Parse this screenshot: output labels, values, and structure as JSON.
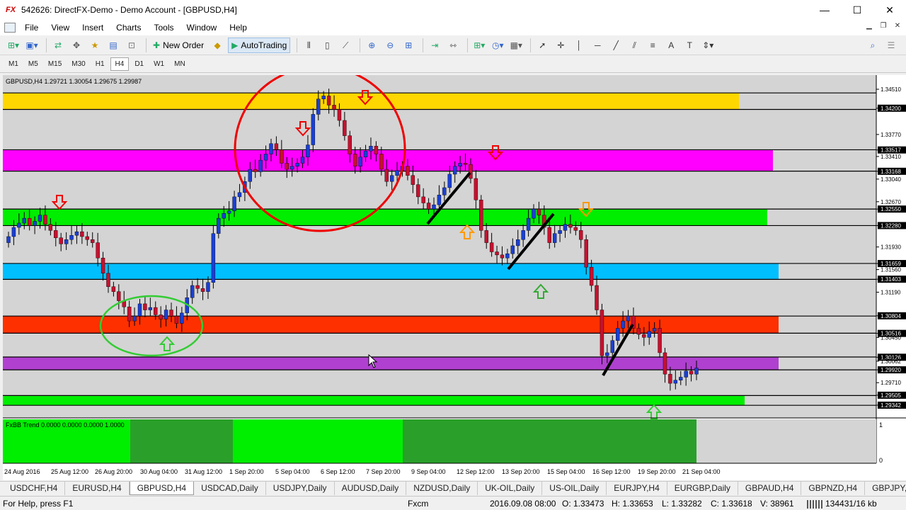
{
  "window": {
    "title": "542626: DirectFX-Demo - Demo Account - [GBPUSD,H4]",
    "app_icon": "FX",
    "minimize": "—",
    "maximize": "☐",
    "close": "✕"
  },
  "menu": [
    "File",
    "View",
    "Insert",
    "Charts",
    "Tools",
    "Window",
    "Help"
  ],
  "toolbar": {
    "new_order": "New Order",
    "autotrading": "AutoTrading"
  },
  "timeframes": [
    "M1",
    "M5",
    "M15",
    "M30",
    "H1",
    "H4",
    "D1",
    "W1",
    "MN"
  ],
  "active_timeframe": "H4",
  "chart": {
    "header": "GBPUSD,H4  1.29721 1.30054 1.29675 1.29987",
    "indicator_label": "FxBB Trend 0.0000 0.0000 0.0000 1.0000",
    "indicator_scale_top": "1",
    "indicator_scale_bottom": "0",
    "price_labels": [
      "1.34510",
      "1.34200",
      "1.33770",
      "1.33517",
      "1.33410",
      "1.33168",
      "1.33040",
      "1.32670",
      "1.32550",
      "1.32280",
      "1.31930",
      "1.31659",
      "1.31560",
      "1.31403",
      "1.31190",
      "1.30804",
      "1.30516",
      "1.30450",
      "1.30126",
      "1.30062",
      "1.29920",
      "1.29710",
      "1.29505",
      "1.29342"
    ],
    "date_labels": [
      "24 Aug 2016",
      "25 Aug 12:00",
      "26 Aug 20:00",
      "30 Aug 04:00",
      "31 Aug 12:00",
      "1 Sep 20:00",
      "5 Sep 04:00",
      "6 Sep 12:00",
      "7 Sep 20:00",
      "9 Sep 04:00",
      "12 Sep 12:00",
      "13 Sep 20:00",
      "15 Sep 04:00",
      "16 Sep 12:00",
      "19 Sep 20:00",
      "21 Sep 04:00"
    ],
    "zones": [
      {
        "color": "#ffd700",
        "top": 1.3445,
        "bottom": 1.3418
      },
      {
        "color": "#ff00ff",
        "top": 1.3352,
        "bottom": 1.3317
      },
      {
        "color": "#00ee00",
        "top": 1.3255,
        "bottom": 1.3228
      },
      {
        "color": "#00bfff",
        "top": 1.3166,
        "bottom": 1.314
      },
      {
        "color": "#ff3000",
        "top": 1.308,
        "bottom": 1.3052
      },
      {
        "color": "#b040d0",
        "top": 1.3013,
        "bottom": 1.2992
      },
      {
        "color": "#00ee00",
        "top": 1.295,
        "bottom": 1.2934
      }
    ]
  },
  "tabs": [
    "USDCHF,H4",
    "EURUSD,H4",
    "GBPUSD,H4",
    "USDCAD,Daily",
    "USDJPY,Daily",
    "AUDUSD,Daily",
    "NZDUSD,Daily",
    "UK-OIL,Daily",
    "US-OIL,Daily",
    "EURJPY,H4",
    "EURGBP,Daily",
    "GBPAUD,H4",
    "GBPNZD,H4",
    "GBPJPY,Daily"
  ],
  "active_tab": "GBPUSD,H4",
  "status": {
    "help": "For Help, press F1",
    "profile": "Fxcm",
    "datetime": "2016.09.08 08:00",
    "open": "O: 1.33473",
    "high": "H: 1.33653",
    "low": "L: 1.33282",
    "close": "C: 1.33618",
    "volume": "V: 38961",
    "traffic": "134431/16 kb"
  }
}
